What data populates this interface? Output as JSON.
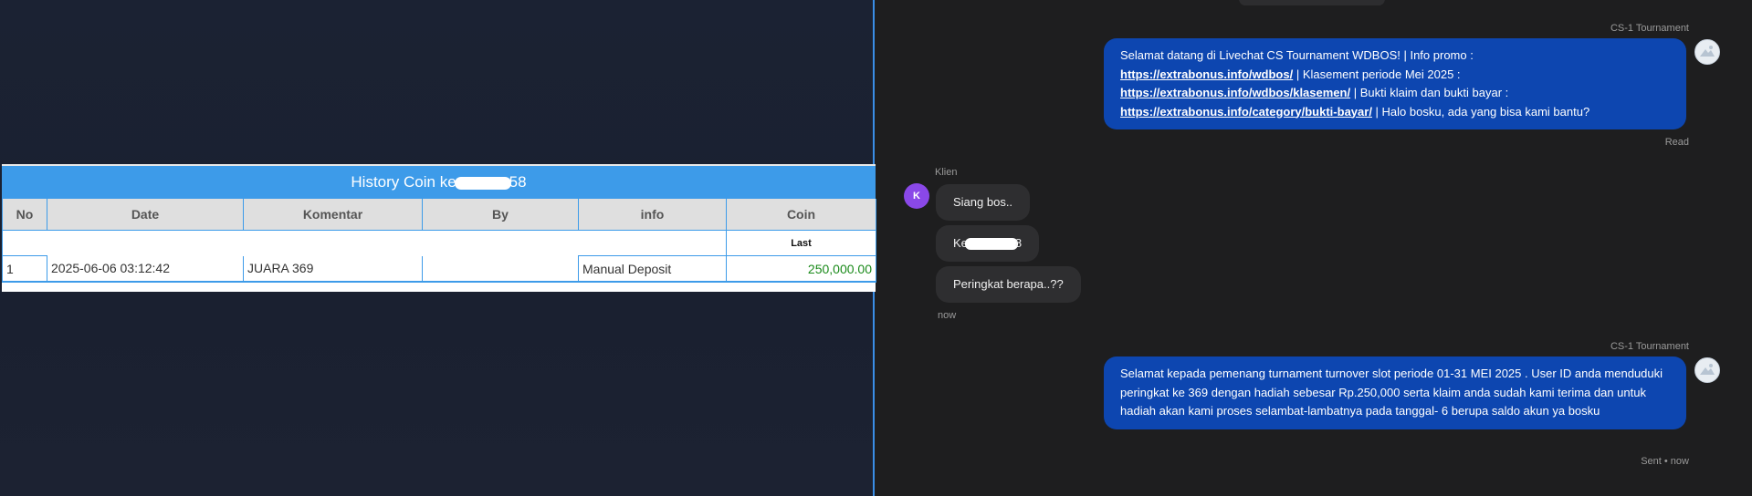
{
  "history": {
    "title_prefix": "History Coin ke",
    "title_suffix": "58",
    "columns": [
      "No",
      "Date",
      "Komentar",
      "By",
      "info",
      "Coin"
    ],
    "last_label": "Last",
    "rows": [
      {
        "no": "1",
        "date": "2025-06-06 03:12:42",
        "komentar": "JUARA 369",
        "by": "",
        "info": "Manual Deposit",
        "coin": "250,000.00"
      }
    ]
  },
  "chat": {
    "agent_name": "CS-1 Tournament",
    "msg1": {
      "line1": "Selamat datang di Livechat CS Tournament WDBOS! | Info promo :",
      "link1": "https://extrabonus.info/wdbos/",
      "after1": " | Klasement periode Mei 2025 :",
      "link2": "https://extrabonus.info/wdbos/klasemen/",
      "after2": " | Bukti klaim dan bukti bayar :",
      "link3": "https://extrabonus.info/category/bukti-bayar/",
      "after3": " | Halo bosku, ada yang bisa kami bantu?",
      "status": "Read"
    },
    "client_name": "Klien",
    "client_initial": "K",
    "client_msgs": [
      "Siang bos..",
      "Ke",
      "8",
      "Peringkat berapa..??"
    ],
    "client_time": "now",
    "msg2": {
      "text": "Selamat kepada pemenang turnament turnover slot periode 01-31 MEI 2025 . User ID anda menduduki peringkat ke 369 dengan hadiah sebesar Rp.250,000 serta klaim anda sudah kami terima dan untuk hadiah akan kami proses selambat-lambatnya pada tanggal- 6 berupa saldo akun ya bosku",
      "status": "Sent • now"
    }
  }
}
